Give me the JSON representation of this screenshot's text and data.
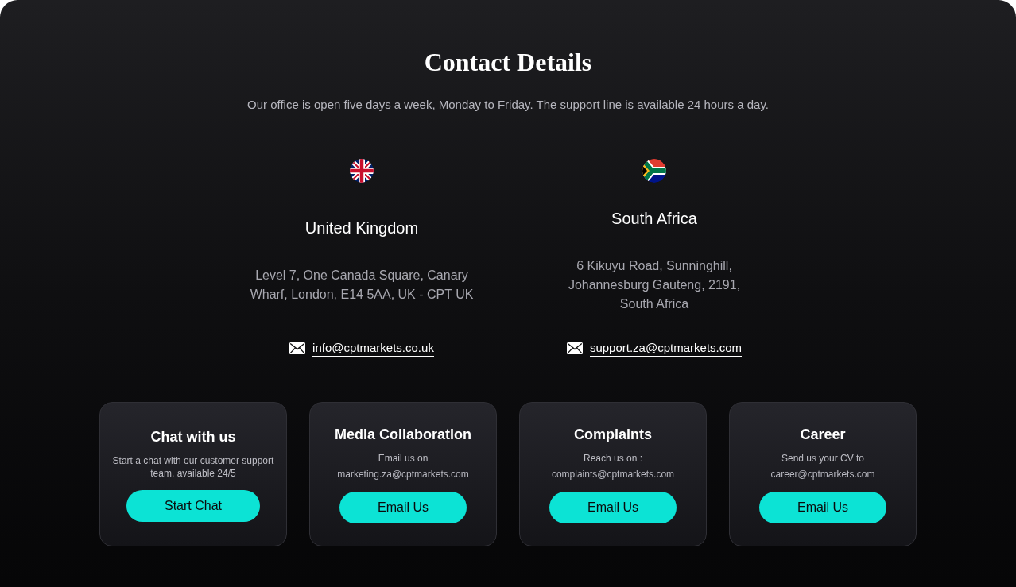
{
  "header": {
    "title": "Contact Details",
    "subtitle": "Our office is open five days a week, Monday to Friday. The support line is available 24 hours a day."
  },
  "offices": [
    {
      "kind": "uk",
      "country": "United Kingdom",
      "address": "Level 7, One Canada Square, Canary\nWharf, London, E14 5AA, UK - CPT UK",
      "email": "info@cptmarkets.co.uk"
    },
    {
      "kind": "za",
      "country": "South Africa",
      "address": "6 Kikuyu Road, Sunninghill,\nJohannesburg Gauteng, 2191,\nSouth Africa",
      "email": "support.za@cptmarkets.com"
    }
  ],
  "cards": [
    {
      "title": "Chat with us",
      "text": "Start a chat with our customer support\nteam, available 24/5",
      "button": "Start Chat"
    },
    {
      "title": "Media Collaboration",
      "text": "Email us on",
      "email": "marketing.za@cptmarkets.com",
      "button": "Email Us"
    },
    {
      "title": "Complaints",
      "text": "Reach us on :",
      "email": "complaints@cptmarkets.com",
      "button": "Email Us"
    },
    {
      "title": "Career",
      "text": "Send us your CV to",
      "email": "career@cptmarkets.com",
      "button": "Email Us"
    }
  ]
}
